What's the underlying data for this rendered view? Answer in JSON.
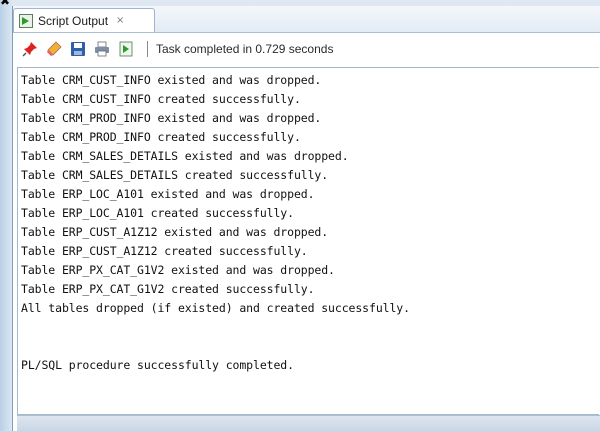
{
  "tab": {
    "label": "Script Output",
    "close_glyph": "×"
  },
  "toolbar": {
    "buttons": [
      {
        "name": "pin-icon",
        "color": "#d02020"
      },
      {
        "name": "eraser-icon",
        "color": "#e09020"
      },
      {
        "name": "save-icon",
        "color": "#2f5fa8"
      },
      {
        "name": "print-icon",
        "color": "#5a6b80"
      },
      {
        "name": "open-file-icon",
        "color": "#3c8c3c"
      }
    ],
    "status": "Task completed in 0.729 seconds"
  },
  "output": {
    "lines": [
      "Table CRM_CUST_INFO existed and was dropped.",
      "Table CRM_CUST_INFO created successfully.",
      "Table CRM_PROD_INFO existed and was dropped.",
      "Table CRM_PROD_INFO created successfully.",
      "Table CRM_SALES_DETAILS existed and was dropped.",
      "Table CRM_SALES_DETAILS created successfully.",
      "Table ERP_LOC_A101 existed and was dropped.",
      "Table ERP_LOC_A101 created successfully.",
      "Table ERP_CUST_A1Z12 existed and was dropped.",
      "Table ERP_CUST_A1Z12 created successfully.",
      "Table ERP_PX_CAT_G1V2 existed and was dropped.",
      "Table ERP_PX_CAT_G1V2 created successfully.",
      "All tables dropped (if existed) and created successfully.",
      "",
      "",
      "PL/SQL procedure successfully completed."
    ]
  }
}
